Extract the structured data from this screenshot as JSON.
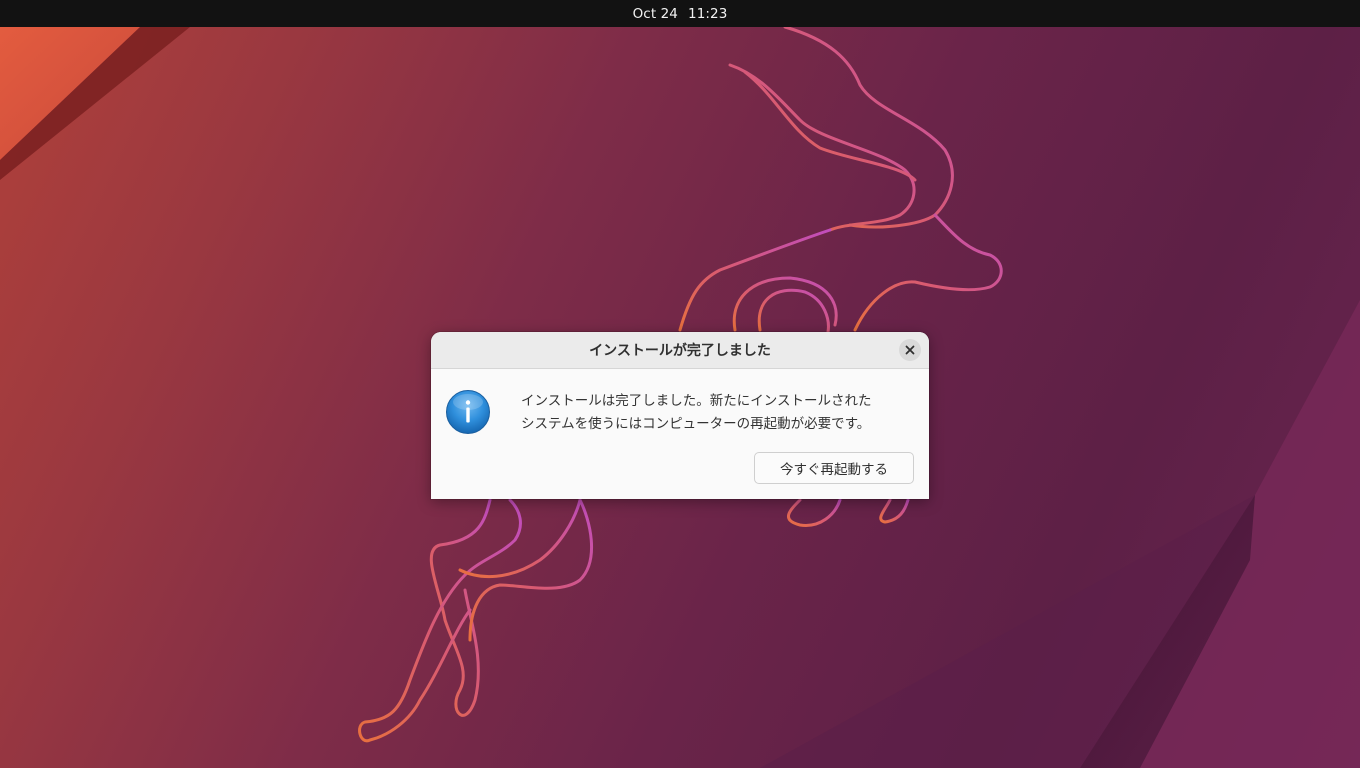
{
  "top_bar": {
    "date": "Oct 24",
    "time": "11:23"
  },
  "dialog": {
    "title": "インストールが完了しました",
    "close_icon": "close-icon",
    "icon": "info-icon",
    "message_line_1": "インストールは完了しました。新たにインストールされた",
    "message_line_2": "システムを使うにはコンピューターの再起動が必要です。",
    "restart_button_label": "今すぐ再起動する"
  },
  "colors": {
    "top_bar": "#121212",
    "dialog_background": "#fafafa",
    "dialog_header": "#ebebeb",
    "info_icon_blue": "#2f8fdc",
    "wallpaper_accent_orange": "#e4633f",
    "wallpaper_mascot_magenta": "#c84fb4"
  }
}
